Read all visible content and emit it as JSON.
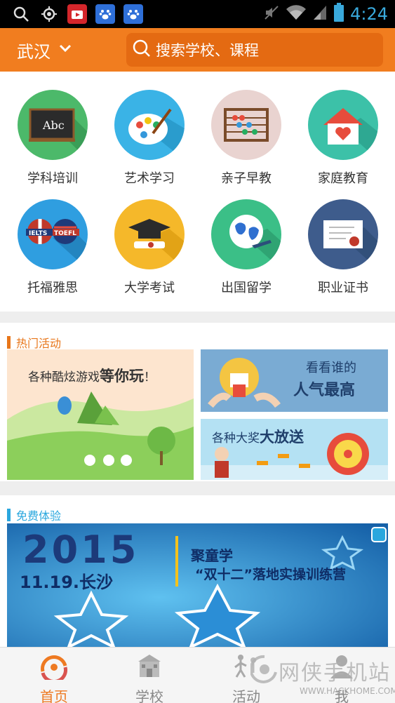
{
  "status_bar": {
    "time": "4:24",
    "icons": [
      "search-icon",
      "gps-icon",
      "tv-app-icon",
      "baidu-paw-icon",
      "baidu-paw-icon",
      "mute-icon",
      "wifi-icon",
      "signal-icon",
      "battery-icon"
    ]
  },
  "header": {
    "city": "武汉",
    "search_placeholder": "搜索学校、课程"
  },
  "categories": [
    {
      "label": "学科培训",
      "icon": "blackboard-icon",
      "color": "#4cb96a"
    },
    {
      "label": "艺术学习",
      "icon": "palette-icon",
      "color": "#3ab3e6"
    },
    {
      "label": "亲子早教",
      "icon": "abacus-icon",
      "color": "#e9d3d0"
    },
    {
      "label": "家庭教育",
      "icon": "house-heart-icon",
      "color": "#3cc1a8"
    },
    {
      "label": "托福雅思",
      "icon": "ielts-toefl-icon",
      "color": "#2f9ee0"
    },
    {
      "label": "大学考试",
      "icon": "graduation-cap-icon",
      "color": "#f5b82a"
    },
    {
      "label": "出国留学",
      "icon": "globe-plane-icon",
      "color": "#3bbf87"
    },
    {
      "label": "职业证书",
      "icon": "certificate-icon",
      "color": "#3e5c8c"
    }
  ],
  "hot_activities": {
    "title": "热门活动",
    "accent": "#e8761a",
    "banners": [
      {
        "text_small": "各种酷炫游戏",
        "text_big": "等你玩",
        "suffix": "！"
      },
      {
        "line1": "看看谁的",
        "line2": "人气最高"
      },
      {
        "text_small": "各种大奖",
        "text_big": "大放送"
      }
    ]
  },
  "free_trial": {
    "title": "免费体验",
    "accent": "#2aa7de",
    "banner": {
      "year": "2015",
      "date_city": "11.19.长沙",
      "org": "聚童学",
      "event": "“双十二”落地实操训练营"
    }
  },
  "bottom_nav": [
    {
      "label": "首页",
      "icon": "home-logo-icon",
      "active": true
    },
    {
      "label": "学校",
      "icon": "school-icon",
      "active": false
    },
    {
      "label": "活动",
      "icon": "activity-icon",
      "active": false
    },
    {
      "label": "我",
      "icon": "person-icon",
      "active": false
    }
  ],
  "watermark": {
    "text": "网侠手机站",
    "url": "WWW.HACKHOME.COM"
  }
}
